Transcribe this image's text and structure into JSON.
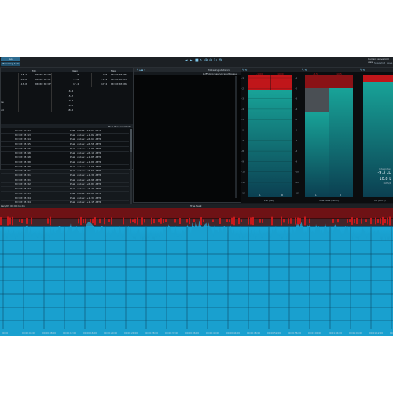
{
  "toolbar": {
    "tab_label": "Go",
    "tab2_label": "Meter/ing Auto",
    "right_title": "Current waveform view",
    "right_sub1": "Snapshot",
    "right_sub2": "Save"
  },
  "stats": {
    "col_headers": [
      "Min",
      "Mean",
      "Max"
    ],
    "rows": [
      [
        "-18.4",
        "00:00:00:07",
        "-1.8",
        "-2.8",
        "00:00:03:05"
      ],
      [
        "-18.8",
        "00:00:00:07",
        "-1.8",
        "-1.9",
        "00:00:03:05"
      ],
      [
        "-13.0",
        "00:00:00:07",
        "17.2",
        "17.2",
        "00:00:03:06"
      ]
    ],
    "left_labels": [
      "",
      "",
      "",
      "ne",
      "",
      "ud",
      ""
    ],
    "summary_values": [
      "-6.4",
      "-5.7",
      "-9.2",
      "-9.3",
      "18.6"
    ]
  },
  "peaks": {
    "header": "True Peak incidents",
    "items": [
      [
        "00:00:05:13",
        "Peak value: +1.05 dBTP"
      ],
      [
        "00:00:05:13",
        "Peak value: +1.02 dBTP"
      ],
      [
        "00:00:05:14",
        "Peak value: +0.64 dBTP"
      ],
      [
        "00:00:05:15",
        "Peak value: +0.58 dBTP"
      ],
      [
        "00:00:05:16",
        "Peak value: +1.09 dBTP"
      ],
      [
        "00:00:05:18",
        "Peak value: +0.11 dBTP"
      ],
      [
        "00:00:05:18",
        "Peak value: +1.05 dBTP"
      ],
      [
        "00:00:05:20",
        "Peak value: +1.01 dBTP"
      ],
      [
        "00:00:05:20",
        "Peak value: +1.60 dBTP"
      ],
      [
        "00:00:05:21",
        "Peak value: +0.51 dBTP"
      ],
      [
        "00:00:05:21",
        "Peak value: +1.31 dBTP"
      ],
      [
        "00:00:05:21",
        "Peak value: +0.98 dBTP"
      ],
      [
        "00:00:05:22",
        "Peak value: +0.87 dBTP"
      ],
      [
        "00:00:05:22",
        "Peak value: +0.71 dBTP"
      ],
      [
        "00:00:05:23",
        "Peak value: +0.66 dBTP"
      ],
      [
        "00:00:05:24",
        "Peak value: +1.37 dBTP"
      ],
      [
        "00:00:05:24",
        "Peak value: +1.15 dBTP"
      ],
      [
        "00:00:05:25",
        "Peak value: +1.42 dBTP"
      ]
    ]
  },
  "middle": {
    "header": "Metering statistics",
    "sub": "LUFS/processing result queue"
  },
  "meters": {
    "scale": [
      "-1",
      "-2",
      "-3",
      "-4",
      "-5",
      "-6",
      "-7",
      "-8",
      "-9",
      "-10",
      "-11",
      "-12"
    ],
    "left_top_labels": [
      "-1000",
      "-1000"
    ],
    "mid_top_labels": [
      "-8.5",
      "-10.5"
    ],
    "left_footer": "Pre (dB)",
    "mid_footer": "True Peak (dBTP)",
    "right_footer": "Int (LUFS)",
    "ch_labels": [
      "L",
      "R",
      "L",
      "R"
    ],
    "readout_title": "Integrated",
    "readout_value": "-9.3 LU",
    "readout_sub": "10.8 L",
    "readout_unit": "LUFS/R"
  },
  "waveform": {
    "title": "True Peak",
    "left_label": "Length: 00:00:15:46",
    "time_labels": [
      "00:00",
      "00:00:04:00",
      "00:00:08:00",
      "00:00:12:00",
      "00:00:16:00",
      "00:00:20:00",
      "00:00:24:00",
      "00:00:28:00",
      "00:00:32:00",
      "00:00:36:00",
      "00:00:40:00",
      "00:00:44:00",
      "00:00:48:00",
      "00:00:52:00",
      "00:00:56:00",
      "00:01:00:00",
      "00:01:04:00",
      "00:01:08:00",
      "00:01:12:00",
      "00:01:16:00"
    ]
  },
  "colors": {
    "accent": "#1a9ac9",
    "peak_red": "#c8191c",
    "dark_red": "#6e1215",
    "teal": "#1a9c8c"
  }
}
